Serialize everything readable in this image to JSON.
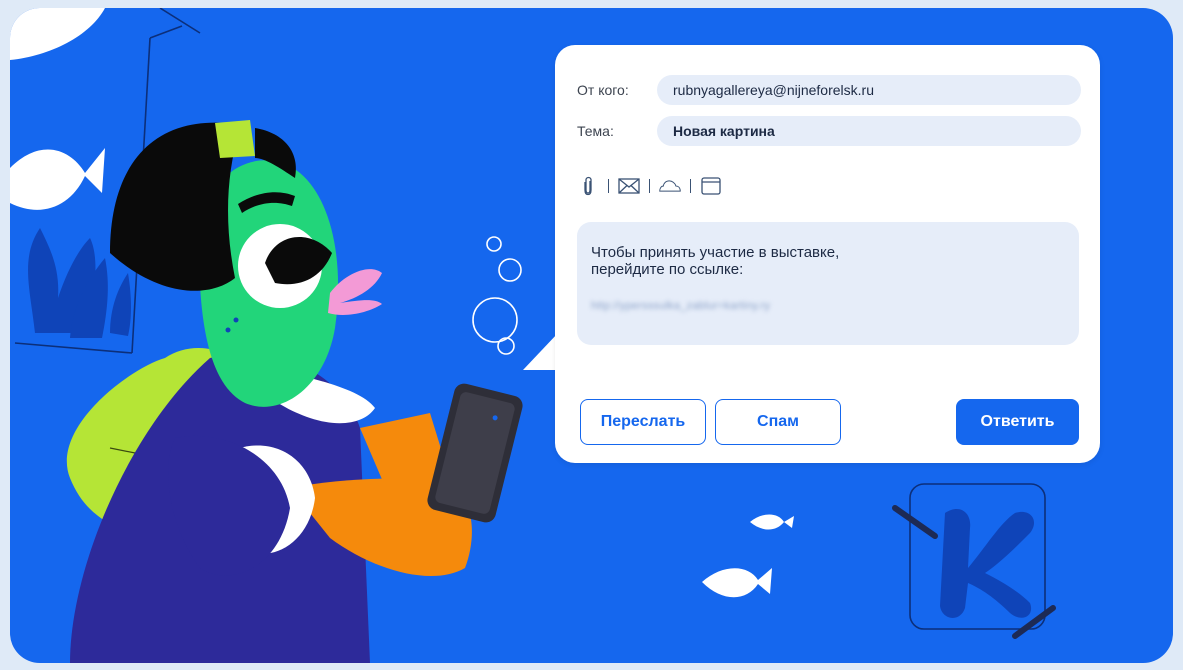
{
  "email": {
    "from_label": "От кого:",
    "from_value": "rubnyagallereya@nijneforelsk.ru",
    "subject_label": "Тема:",
    "subject_value": "Новая картина",
    "toolbar": {
      "icons": [
        "paperclip-icon",
        "envelope-icon",
        "cloud-icon",
        "window-icon"
      ]
    },
    "message": "Чтобы принять участие в выставке,\nперейдите по ссылке:",
    "link": "http://ypersssulka_zablur=kartiny.ry",
    "buttons": {
      "forward": "Переслать",
      "spam": "Спам",
      "reply": "Ответить"
    }
  },
  "colors": {
    "background": "#1567ee",
    "card": "#ffffff",
    "field_fill": "#e6edf9",
    "accent": "#1567ee",
    "fish_green": "#22d57a"
  }
}
